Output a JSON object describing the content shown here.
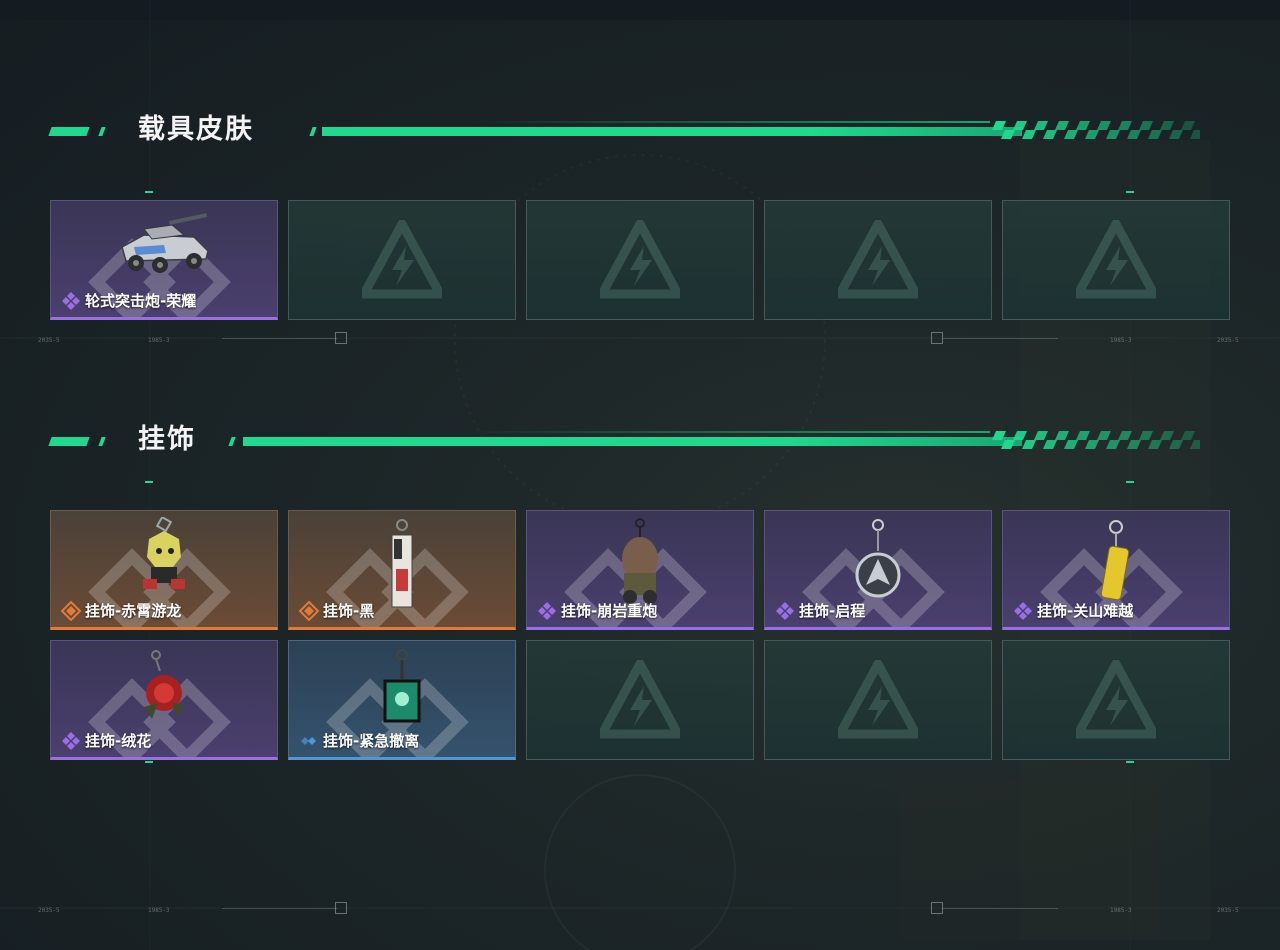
{
  "sections": {
    "vehicle": {
      "title": "载具皮肤"
    },
    "pendant": {
      "title": "挂饰"
    }
  },
  "vehicle_items": [
    {
      "label": "轮式突击炮-荣耀",
      "rarity": "purple",
      "icon": "armored-car"
    },
    {
      "label": "",
      "rarity": "empty"
    },
    {
      "label": "",
      "rarity": "empty"
    },
    {
      "label": "",
      "rarity": "empty"
    },
    {
      "label": "",
      "rarity": "empty"
    }
  ],
  "pendant_items": [
    {
      "label": "挂饰-赤霄游龙",
      "rarity": "orange",
      "icon": "dragon-figure"
    },
    {
      "label": "挂饰-黑",
      "rarity": "orange",
      "icon": "tag-charm"
    },
    {
      "label": "挂饰-崩岩重炮",
      "rarity": "purple",
      "icon": "sack-figure"
    },
    {
      "label": "挂饰-启程",
      "rarity": "purple",
      "icon": "emblem-medal"
    },
    {
      "label": "挂饰-关山难越",
      "rarity": "purple",
      "icon": "yellow-canister"
    },
    {
      "label": "挂饰-绒花",
      "rarity": "purple",
      "icon": "red-rose"
    },
    {
      "label": "挂饰-紧急撤离",
      "rarity": "blue",
      "icon": "green-cube"
    },
    {
      "label": "",
      "rarity": "empty"
    },
    {
      "label": "",
      "rarity": "empty"
    },
    {
      "label": "",
      "rarity": "empty"
    }
  ],
  "hud": {
    "stamp_left": "2035-5",
    "stamp_mid": "1985-3"
  },
  "colors": {
    "accent": "#1ed98e",
    "rarity_purple": "#9a6ee6",
    "rarity_orange": "#e07b3c",
    "rarity_blue": "#4f97d8"
  }
}
